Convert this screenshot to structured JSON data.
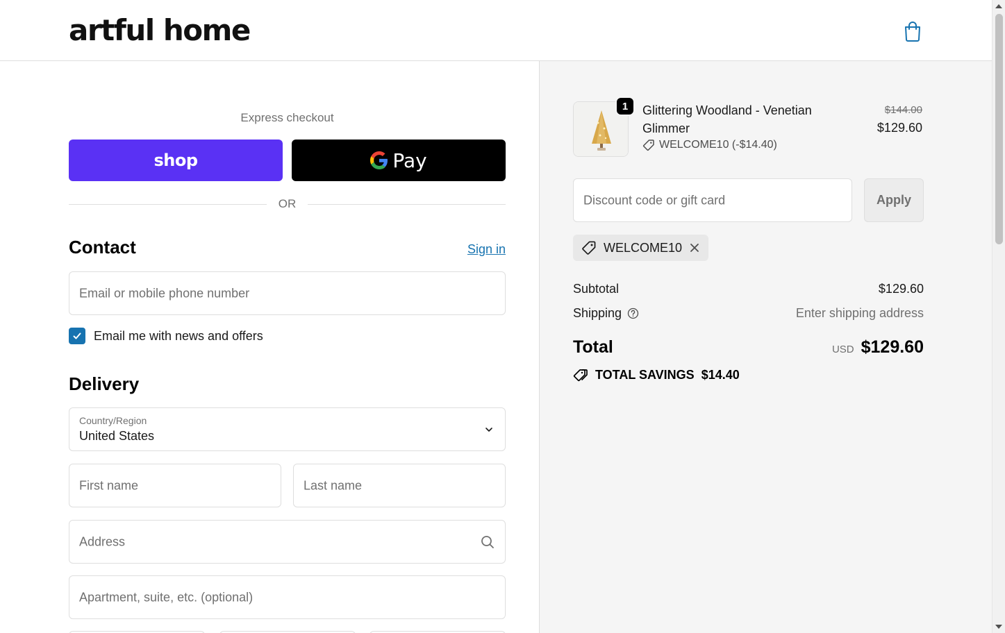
{
  "header": {
    "logo": "artful home",
    "cart_icon": "shopping-bag-icon"
  },
  "express": {
    "title": "Express checkout",
    "shop_label": "shop",
    "gpay_label": "Pay",
    "or_label": "OR"
  },
  "contact": {
    "title": "Contact",
    "signin_label": "Sign in",
    "email_placeholder": "Email or mobile phone number",
    "newsletter_label": "Email me with news and offers",
    "newsletter_checked": true
  },
  "delivery": {
    "title": "Delivery",
    "country_label": "Country/Region",
    "country_value": "United States",
    "first_name_placeholder": "First name",
    "last_name_placeholder": "Last name",
    "address_placeholder": "Address",
    "apartment_placeholder": "Apartment, suite, etc. (optional)"
  },
  "order": {
    "item": {
      "quantity": "1",
      "name": "Glittering Woodland - Venetian Glimmer",
      "discount": "WELCOME10 (-$14.40)",
      "original_price": "$144.00",
      "price": "$129.60"
    },
    "discount_placeholder": "Discount code or gift card",
    "apply_label": "Apply",
    "applied_code": "WELCOME10",
    "subtotal_label": "Subtotal",
    "subtotal_value": "$129.60",
    "shipping_label": "Shipping",
    "shipping_value": "Enter shipping address",
    "total_label": "Total",
    "total_currency": "USD",
    "total_value": "$129.60",
    "savings_label": "TOTAL SAVINGS",
    "savings_value": "$14.40"
  },
  "colors": {
    "shop_purple": "#5a31f4",
    "link_blue": "#1773b0",
    "summary_bg": "#f5f5f5"
  }
}
